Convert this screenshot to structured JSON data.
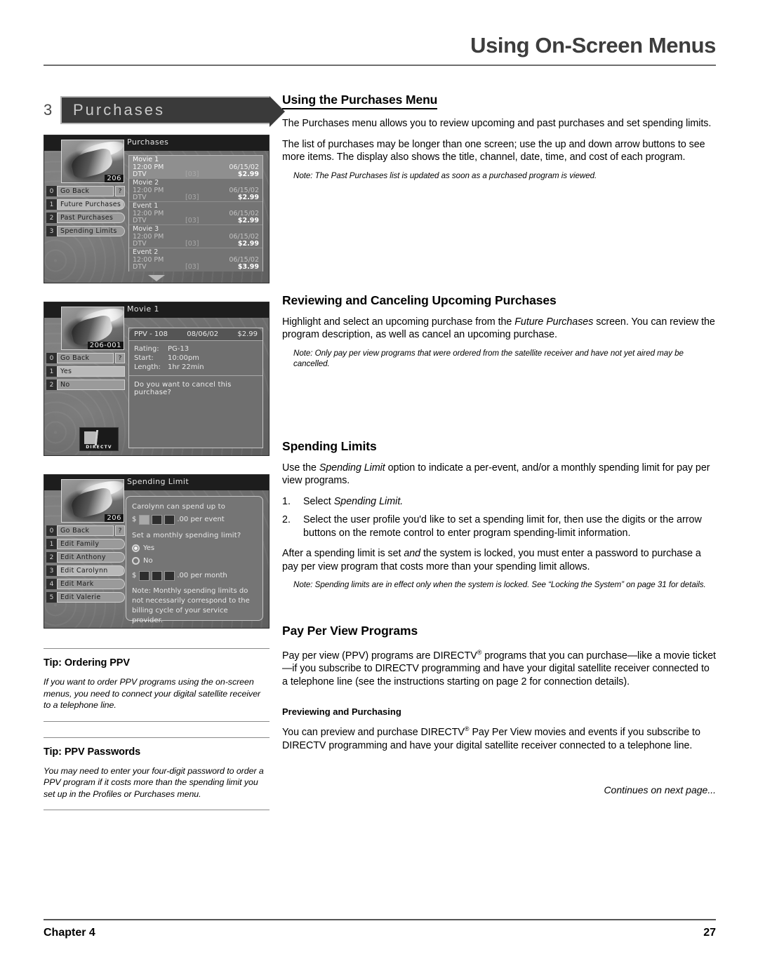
{
  "header": {
    "title": "Using On-Screen Menus"
  },
  "tab": {
    "number": "3",
    "label": "Purchases"
  },
  "screens": {
    "purchases": {
      "title": "Purchases",
      "channel": "206",
      "menu": [
        {
          "key": "0",
          "label": "Go Back",
          "help": "?"
        },
        {
          "key": "1",
          "label": "Future Purchases"
        },
        {
          "key": "2",
          "label": "Past Purchases"
        },
        {
          "key": "3",
          "label": "Spending Limits"
        }
      ],
      "columns": [
        "title",
        "time",
        "date",
        "source",
        "rating",
        "price"
      ],
      "rows": [
        {
          "title": "Movie 1",
          "time": "12:00 PM",
          "date": "06/15/02",
          "source": "DTV",
          "rating": "[03]",
          "price": "$2.99"
        },
        {
          "title": "Movie 2",
          "time": "12:00 PM",
          "date": "06/15/02",
          "source": "DTV",
          "rating": "[03]",
          "price": "$2.99"
        },
        {
          "title": "Event 1",
          "time": "12:00 PM",
          "date": "06/15/02",
          "source": "DTV",
          "rating": "[03]",
          "price": "$2.99"
        },
        {
          "title": "Movie 3",
          "time": "12:00 PM",
          "date": "06/15/02",
          "source": "DTV",
          "rating": "[03]",
          "price": "$2.99"
        },
        {
          "title": "Event 2",
          "time": "12:00 PM",
          "date": "06/15/02",
          "source": "DTV",
          "rating": "[03]",
          "price": "$3.99"
        }
      ]
    },
    "cancel": {
      "title": "Movie 1",
      "channel": "206-001",
      "menu": [
        {
          "key": "0",
          "label": "Go Back",
          "help": "?"
        },
        {
          "key": "1",
          "label": "Yes"
        },
        {
          "key": "2",
          "label": "No"
        }
      ],
      "detail_header": {
        "channel": "PPV - 108",
        "date": "08/06/02",
        "price": "$2.99"
      },
      "detail_rows": [
        {
          "key": "Rating:",
          "value": "PG-13"
        },
        {
          "key": "Start:",
          "value": "10:00pm"
        },
        {
          "key": "Length:",
          "value": "1hr 22min"
        }
      ],
      "question": "Do you want to cancel this purchase?",
      "logo_text": "DIRECTV"
    },
    "spending": {
      "title": "Spending Limit",
      "channel": "206",
      "menu": [
        {
          "key": "0",
          "label": "Go Back",
          "help": "?"
        },
        {
          "key": "1",
          "label": "Edit Family"
        },
        {
          "key": "2",
          "label": "Edit Anthony"
        },
        {
          "key": "3",
          "label": "Edit Carolynn"
        },
        {
          "key": "4",
          "label": "Edit Mark"
        },
        {
          "key": "5",
          "label": "Edit Valerie"
        }
      ],
      "spend_line": "Carolynn can spend up to",
      "per_event_suffix": ".00 per event",
      "monthly_question": "Set a monthly spending limit?",
      "yes_label": "Yes",
      "no_label": "No",
      "per_month_suffix": ".00 per month",
      "dollar_sign": "$",
      "note": "Note: Monthly spending limits do not necessarily correspond to the billing cycle of your service provider."
    }
  },
  "sections": {
    "purchases_menu": {
      "heading": "Using the Purchases Menu",
      "p1": "The Purchases menu allows you to review upcoming and past purchases and set spending limits.",
      "p2": "The list of purchases may be longer than one screen; use the up and down arrow buttons to see more items. The display also shows the title, channel, date, time, and cost of each program.",
      "note": "Note: The Past Purchases list is updated as soon as a purchased program is viewed."
    },
    "reviewing": {
      "heading": "Reviewing and Canceling Upcoming Purchases",
      "p1_a": "Highlight and select an upcoming purchase from the ",
      "p1_i": "Future Purchases",
      "p1_b": " screen. You can review the program description, as well as cancel an upcoming purchase.",
      "note": "Note: Only pay per view programs that were ordered from the satellite receiver and have not yet aired may be cancelled."
    },
    "spending_limits": {
      "heading": "Spending Limits",
      "p1_a": "Use the ",
      "p1_i": "Spending Limit",
      "p1_b": " option to indicate a per-event, and/or a monthly spending limit for pay per view programs.",
      "step1_num": "1.",
      "step1_a": "Select ",
      "step1_i": "Spending Limit.",
      "step2_num": "2.",
      "step2": "Select the user profile you'd like to set a spending limit for, then use the digits or the arrow buttons on the remote control to enter program spending-limit information.",
      "p2_a": "After a spending limit is set ",
      "p2_i": "and",
      "p2_b": " the system is locked, you must enter a password to purchase a pay per view program that costs more than your spending limit allows.",
      "note": "Note: Spending limits are in effect only when the system is locked. See “Locking the System” on page 31 for details."
    },
    "ppv": {
      "heading": "Pay Per View Programs",
      "p1_a": "Pay per view (PPV) programs are DIRECTV",
      "p1_sup": "®",
      "p1_b": " programs that you can purchase—like a movie ticket—if you subscribe to DIRECTV programming and have your digital satellite receiver connected to a telephone line (see the instructions  starting on page 2 for connection details).",
      "subheading": "Previewing and Purchasing",
      "p2_a": "You can preview and purchase DIRECTV",
      "p2_sup": "®",
      "p2_b": " Pay Per View movies and events if you subscribe to DIRECTV programming and have your digital satellite receiver connected to a telephone line.",
      "continues": "Continues on next page..."
    }
  },
  "tips": [
    {
      "title": "Tip: Ordering PPV",
      "body": "If you want to order PPV programs using the on-screen menus, you need to connect your digital satellite receiver to a telephone line."
    },
    {
      "title": "Tip: PPV Passwords",
      "body": "You may need to enter your four-digit password to order a PPV program if it costs more than the spending limit you set up in the Profiles or Purchases menu."
    }
  ],
  "footer": {
    "chapter": "Chapter 4",
    "page": "27"
  }
}
